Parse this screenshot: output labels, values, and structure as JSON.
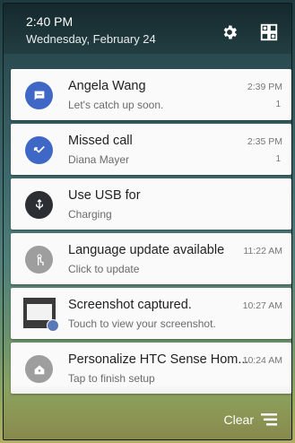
{
  "status": {
    "time": "2:40 PM",
    "date": "Wednesday, February 24"
  },
  "notifications": [
    {
      "title": "Angela Wang",
      "subtitle": "Let's catch up soon.",
      "time": "2:39 PM",
      "count": "1",
      "icon": "message-icon",
      "color": "#3f67c5"
    },
    {
      "title": "Missed call",
      "subtitle": "Diana Mayer",
      "time": "2:35 PM",
      "count": "1",
      "icon": "missed-call-icon",
      "color": "#3f67c5"
    },
    {
      "title": "Use USB for",
      "subtitle": "Charging",
      "time": "",
      "count": "",
      "icon": "usb-icon",
      "color": "#2b2f33"
    },
    {
      "title": "Language update available",
      "subtitle": "Click to update",
      "time": "11:22 AM",
      "count": "",
      "icon": "touch-icon",
      "color": "#9e9e9e"
    },
    {
      "title": "Screenshot captured.",
      "subtitle": "Touch to view your screenshot.",
      "time": "10:27 AM",
      "count": "",
      "icon": "screenshot-thumbnail",
      "color": "#3a3a3a"
    },
    {
      "title": "Personalize HTC Sense Hom...",
      "subtitle": "Tap to finish setup",
      "time": "10:24 AM",
      "count": "",
      "icon": "home-icon",
      "color": "#9e9e9e"
    }
  ],
  "footer": {
    "clear_label": "Clear"
  }
}
